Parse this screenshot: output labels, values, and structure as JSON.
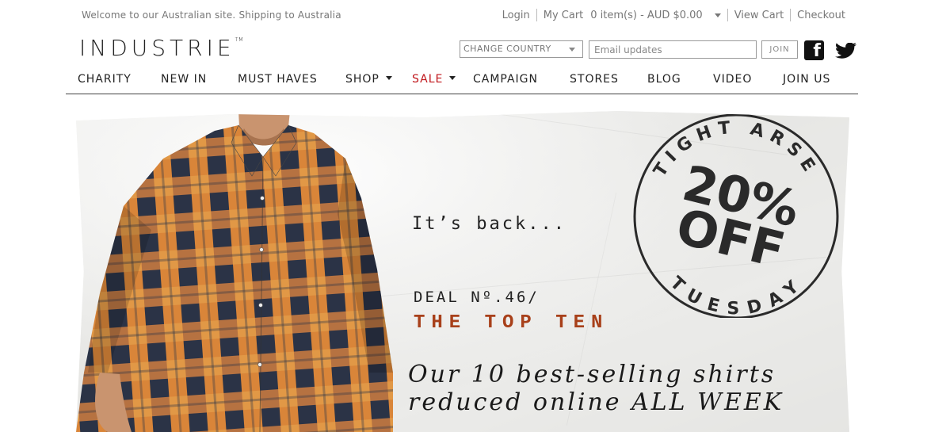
{
  "header": {
    "welcome": "Welcome to our Australian site. Shipping to Australia",
    "login": "Login",
    "my_cart": "My Cart",
    "cart_summary": "0 item(s) - AUD $0.00",
    "view_cart": "View Cart",
    "checkout": "Checkout",
    "logo": "INDUSTRIE",
    "logo_mark": "TM",
    "country_select": "CHANGE COUNTRY",
    "email_placeholder": "Email updates",
    "join_button": "JOIN"
  },
  "nav": {
    "items": [
      "CHARITY",
      "NEW IN",
      "MUST HAVES",
      "SHOP",
      "SALE",
      "CAMPAIGN",
      "STORES",
      "BLOG",
      "VIDEO",
      "JOIN US"
    ]
  },
  "banner": {
    "its_back": "It’s back...",
    "deal": "DEAL Nº.46/",
    "headline": "THE TOP TEN",
    "line1": "Our 10 best-selling shirts",
    "line2": "reduced online ALL WEEK",
    "stamp_top": "TIGHT ARSE",
    "stamp_discount_1": "20%",
    "stamp_discount_2": "OFF",
    "stamp_bottom": "TUESDAY"
  },
  "colors": {
    "sale": "#c0161b",
    "headline": "#a8401a"
  }
}
